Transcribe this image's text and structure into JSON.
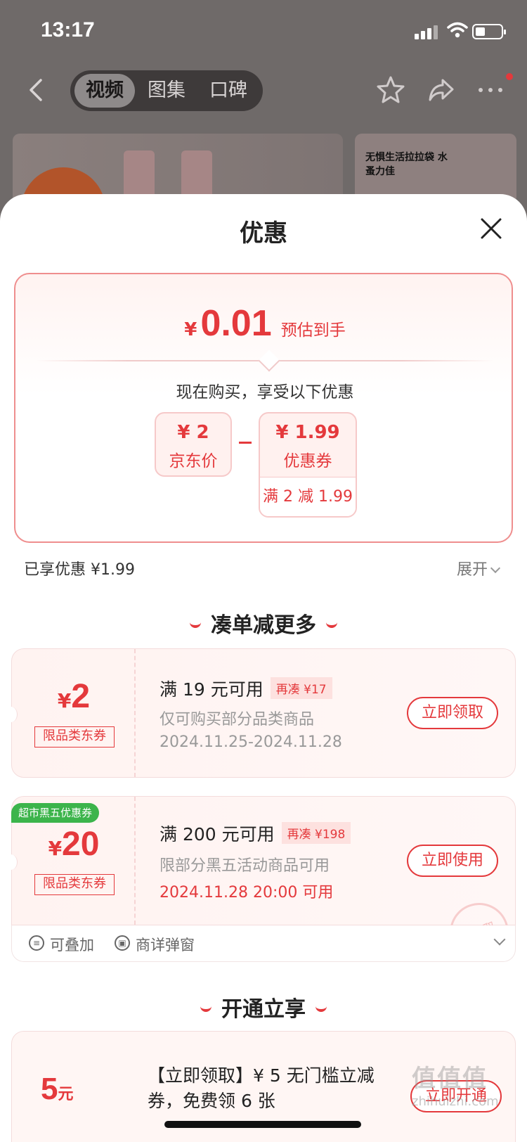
{
  "status": {
    "time": "13:17"
  },
  "nav": {
    "tabs": [
      "视频",
      "图集",
      "口碑"
    ],
    "active_tab": 0
  },
  "background": {
    "banner_text": "无惧生活拉拉袋 水蚤力佳"
  },
  "sheet": {
    "title": "优惠",
    "estimate": {
      "currency": "¥",
      "amount": "0.01",
      "label": "预估到手"
    },
    "buy_note": "现在购买，享受以下优惠",
    "jd_price": {
      "value": "¥ 2",
      "label": "京东价"
    },
    "coupon_price": {
      "value": "¥ 1.99",
      "label": "优惠券",
      "rule": "满 2 减 1.99"
    },
    "enjoyed": "已享优惠 ¥1.99",
    "expand": "展开",
    "section1": "凑单减更多",
    "coupons": [
      {
        "currency": "¥",
        "amount": "2",
        "tag": "限品类东券",
        "title": "满 19 元可用",
        "badge": "再凑 ¥17",
        "desc": "仅可购买部分品类商品",
        "date": "2024.11.25-2024.11.28",
        "button": "立即领取"
      },
      {
        "currency": "¥",
        "amount": "20",
        "tag": "限品类东券",
        "title": "满 200 元可用",
        "badge": "再凑 ¥198",
        "desc": "限部分黑五活动商品可用",
        "date": "2024.11.28 20:00 可用",
        "button": "立即使用",
        "corner_tag": "超市黑五优惠券",
        "stamp": "已领取"
      }
    ],
    "stack_row": {
      "stackable": "可叠加",
      "popup": "商详弹窗"
    },
    "section2": "开通立享",
    "vip": {
      "amount": "5",
      "unit": "元",
      "title": "【立即领取】¥ 5 无门槛立减券，免费领 6 张",
      "button": "立即开通"
    }
  },
  "watermark": {
    "main": "值值值",
    "sub": "zhihuizhi.com"
  },
  "colors": {
    "accent": "#e4393c",
    "badge_green": "#3cb44b"
  }
}
